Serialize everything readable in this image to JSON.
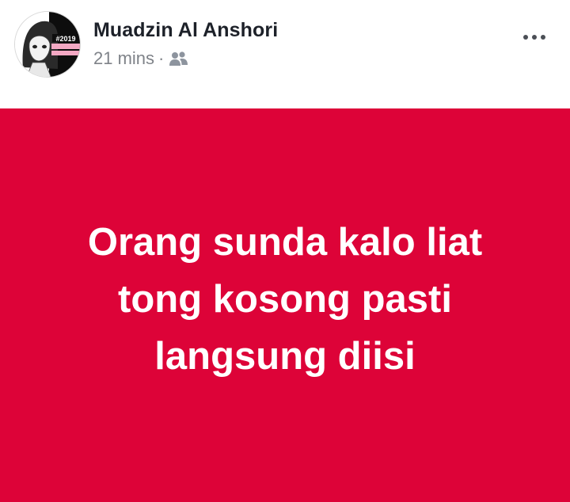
{
  "post": {
    "author": "Muadzin Al Anshori",
    "time": "21 mins",
    "separator": "·",
    "privacy_icon": "friends-icon",
    "avatar_badge": "#2019",
    "more_icon": "more-options-icon",
    "text_lines": [
      "Orang sunda kalo liat",
      "tong kosong pasti",
      "langsung diisi"
    ]
  },
  "colors": {
    "card_background": "#dd0338",
    "text": "#ffffff",
    "name": "#1d2129",
    "meta": "#7f8389"
  }
}
